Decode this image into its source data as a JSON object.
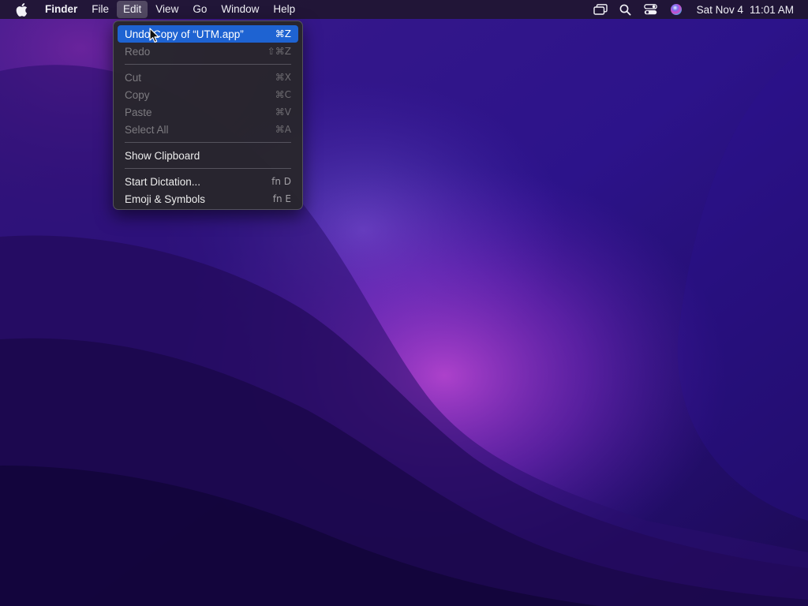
{
  "menubar": {
    "apple_icon": "apple-icon",
    "app_name": "Finder",
    "menus": [
      {
        "label": "File"
      },
      {
        "label": "Edit"
      },
      {
        "label": "View"
      },
      {
        "label": "Go"
      },
      {
        "label": "Window"
      },
      {
        "label": "Help"
      }
    ],
    "active_menu": "Edit",
    "status_icons": [
      "screen-mirroring-icon",
      "spotlight-search-icon",
      "control-center-icon",
      "siri-icon"
    ],
    "date": "Sat Nov 4",
    "time": "11:01 AM"
  },
  "edit_menu": {
    "items": [
      {
        "label": "Undo Copy of “UTM.app”",
        "shortcut": "⌘Z",
        "enabled": true,
        "highlighted": true
      },
      {
        "label": "Redo",
        "shortcut": "⇧⌘Z",
        "enabled": false
      }
    ],
    "group2": [
      {
        "label": "Cut",
        "shortcut": "⌘X",
        "enabled": false
      },
      {
        "label": "Copy",
        "shortcut": "⌘C",
        "enabled": false
      },
      {
        "label": "Paste",
        "shortcut": "⌘V",
        "enabled": false
      },
      {
        "label": "Select All",
        "shortcut": "⌘A",
        "enabled": false
      }
    ],
    "group3": [
      {
        "label": "Show Clipboard",
        "shortcut": "",
        "enabled": true
      }
    ],
    "group4": [
      {
        "label": "Start Dictation...",
        "shortcut": "fn D",
        "enabled": true
      },
      {
        "label": "Emoji & Symbols",
        "shortcut": "fn E",
        "enabled": true
      }
    ]
  },
  "colors": {
    "menu_highlight": "#1e63d2",
    "menubar_bg": "#20163a",
    "wallpaper_dark": "#1e0a4a",
    "wallpaper_accent": "#a63cd4"
  }
}
